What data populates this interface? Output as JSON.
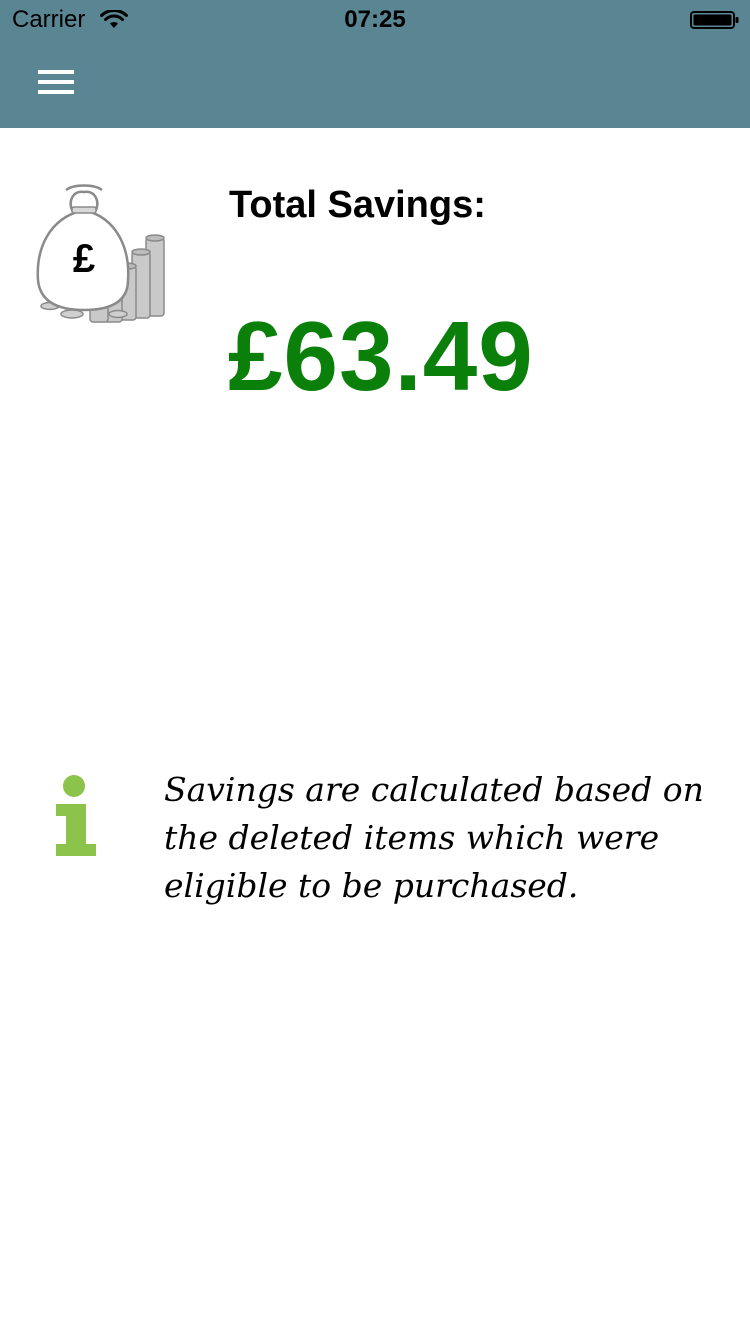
{
  "status_bar": {
    "carrier": "Carrier",
    "time": "07:25",
    "wifi_icon": "wifi-icon",
    "battery_icon": "battery-icon"
  },
  "header": {
    "background_color": "#5a8593",
    "menu_icon": "hamburger-menu-icon"
  },
  "savings": {
    "icon": "money-bag-coins-icon",
    "title": "Total Savings:",
    "amount": "£63.49",
    "amount_color": "#0a7f0a"
  },
  "info": {
    "icon": "info-icon",
    "icon_color": "#8cc34a",
    "text": "Savings are calculated based on the deleted items which were eligible to be purchased."
  }
}
